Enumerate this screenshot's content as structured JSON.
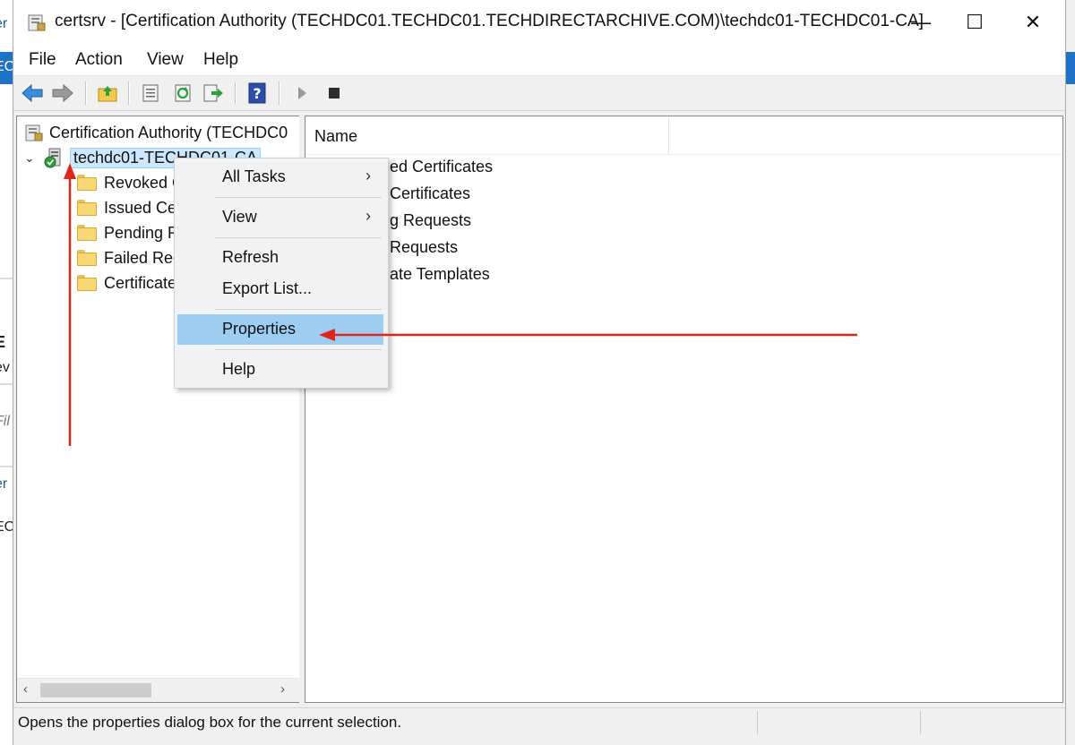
{
  "background_window": {
    "fragments": [
      "er",
      "EC",
      "E",
      "ev",
      "Fil",
      "er",
      "EC"
    ]
  },
  "window": {
    "title": "certsrv - [Certification Authority (TECHDC01.TECHDC01.TECHDIRECTARCHIVE.COM)\\techdc01-TECHDC01-CA]",
    "controls": {
      "minimize": "—",
      "maximize": "☐",
      "close": "✕"
    }
  },
  "menubar": {
    "items": [
      "File",
      "Action",
      "View",
      "Help"
    ]
  },
  "toolbar": {
    "icons": [
      "back-arrow-icon",
      "forward-arrow-icon",
      "up-folder-icon",
      "properties-sheet-icon",
      "refresh-icon",
      "export-list-icon",
      "help-icon",
      "start-service-icon",
      "stop-service-icon"
    ]
  },
  "tree": {
    "root": "Certification Authority (TECHDC0",
    "ca_node": "techdc01-TECHDC01-CA",
    "children": [
      "Revoked C",
      "Issued Ce",
      "Pending R",
      "Failed Req",
      "Certificate"
    ]
  },
  "list": {
    "column_name": "Name",
    "items": [
      "ed Certificates",
      "Certificates",
      "g Requests",
      "Requests",
      "ate Templates"
    ]
  },
  "context_menu": {
    "items": [
      {
        "label": "All Tasks",
        "submenu": "›"
      },
      {
        "label": "View",
        "submenu": "›"
      },
      {
        "label": "Refresh"
      },
      {
        "label": "Export List..."
      },
      {
        "label": "Properties"
      },
      {
        "label": "Help"
      }
    ]
  },
  "scrollbar": {
    "left": "‹",
    "right": "›"
  },
  "statusbar": {
    "text": "Opens the properties dialog box for the current selection."
  },
  "colors": {
    "annotation_arrow": "#e0251b",
    "highlight": "#9ecdf2",
    "selection": "#cce8ff"
  }
}
